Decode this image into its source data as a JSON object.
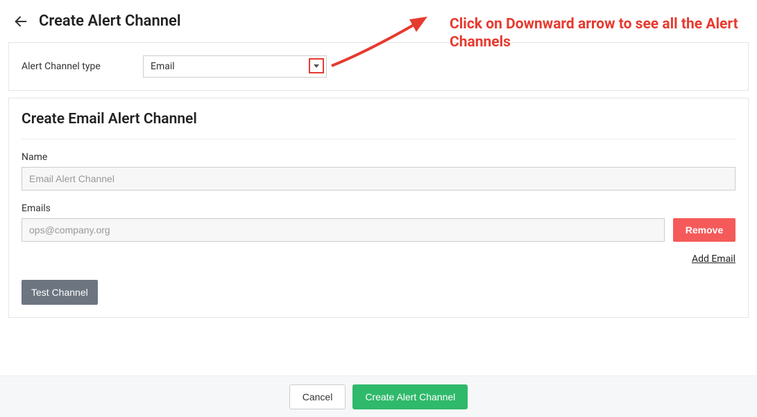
{
  "header": {
    "title": "Create Alert Channel"
  },
  "channel_type": {
    "label": "Alert Channel type",
    "selected": "Email"
  },
  "form": {
    "section_title": "Create Email Alert Channel",
    "name_label": "Name",
    "name_placeholder": "Email Alert Channel",
    "name_value": "",
    "emails_label": "Emails",
    "email_placeholder": "ops@company.org",
    "email_value": "",
    "remove_label": "Remove",
    "add_email_label": "Add Email",
    "test_label": "Test Channel"
  },
  "footer": {
    "cancel_label": "Cancel",
    "submit_label": "Create Alert Channel"
  },
  "annotation": {
    "text": "Click on Downward arrow to see all the Alert Channels"
  },
  "colors": {
    "annotation_red": "#e73a2f",
    "primary_green": "#2fb96b",
    "danger_red": "#f55a5a",
    "secondary_gray": "#6c7580"
  }
}
